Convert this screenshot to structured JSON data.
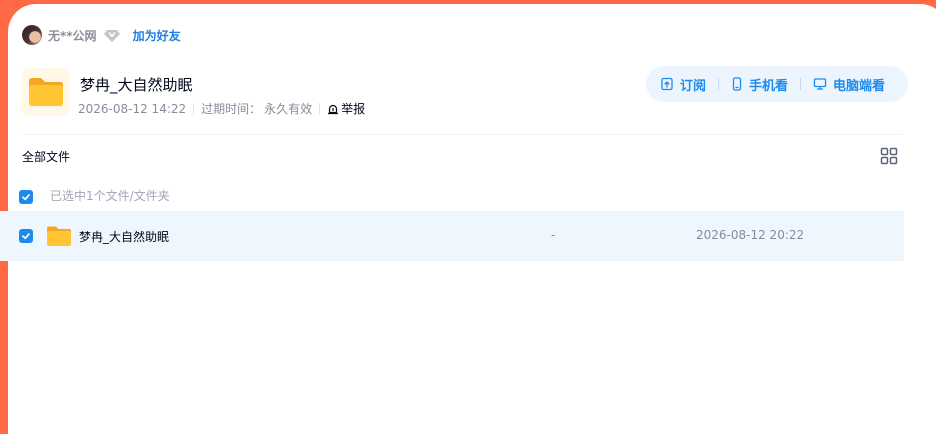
{
  "share": {
    "sharer_name": "无**公网",
    "add_friend_label": "加为好友",
    "folder_title": "梦冉_大自然助眠",
    "created": "2026-08-12 14:22",
    "expiry_label": "过期时间：",
    "expiry_value": "永久有效",
    "report_label": "举报"
  },
  "actions": {
    "subscribe_label": "订阅",
    "mobile_label": "手机看",
    "pc_label": "电脑端看"
  },
  "files": {
    "breadcrumb": "全部文件",
    "selection_text": "已选中1个文件/文件夹",
    "selection_checked": true,
    "items": [
      {
        "name": "梦冉_大自然助眠",
        "size": "-",
        "modified": "2026-08-12 20:22",
        "checked": true,
        "type": "folder"
      }
    ]
  },
  "icons": {
    "diamond": "diamond-icon",
    "report": "report-icon",
    "subscribe": "subscribe-icon",
    "mobile": "phone-icon",
    "pc": "monitor-icon",
    "view_toggle": "grid-view-icon",
    "folder": "folder-icon",
    "checkbox": "check-icon"
  },
  "colors": {
    "page_border": "#ff6a45",
    "accent": "#1d8bee",
    "link": "#1d7fe2",
    "selected_row": "#eef6fe",
    "actions_bg": "#ecf5fe",
    "folder": "#ffc533"
  }
}
